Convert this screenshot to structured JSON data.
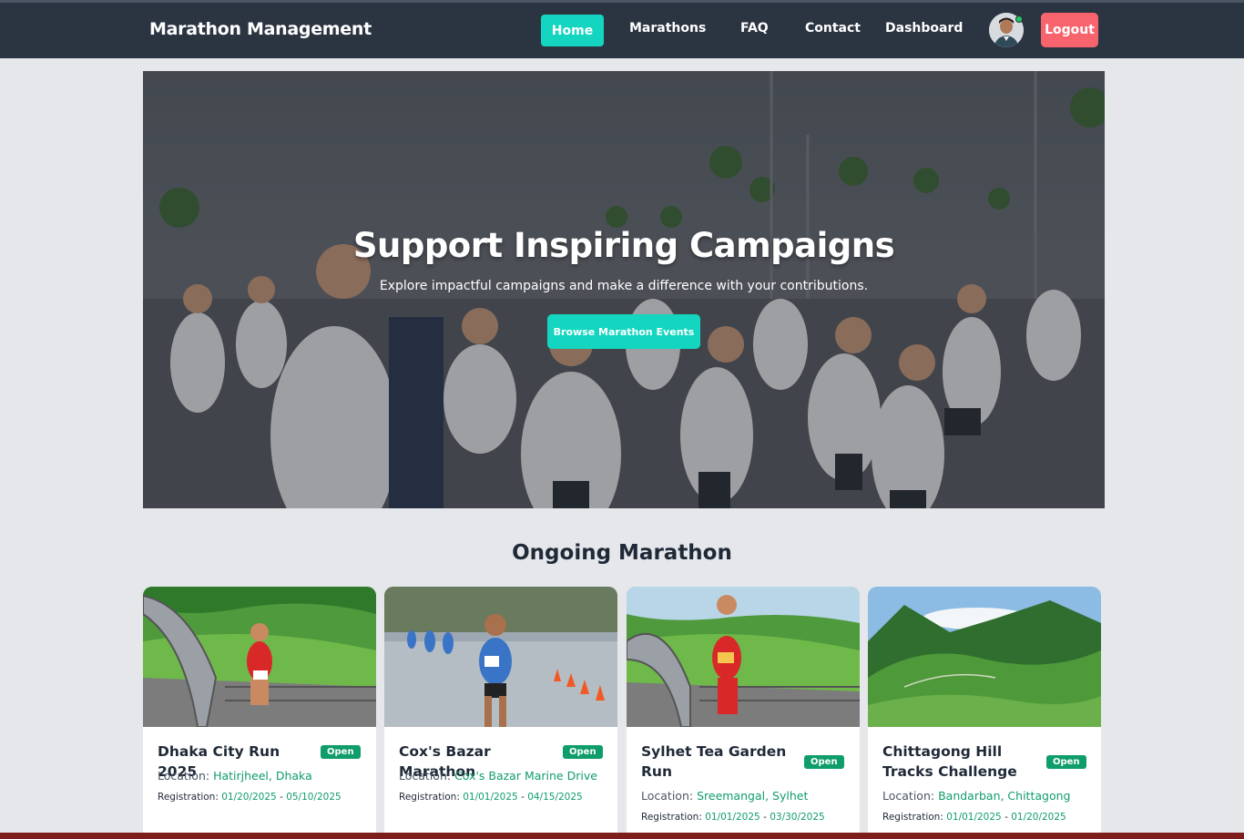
{
  "navbar": {
    "brand": "Marathon Management",
    "links": {
      "home": "Home",
      "marathons": "Marathons",
      "faq": "FAQ",
      "contact": "Contact",
      "dashboard": "Dashboard"
    },
    "logout": "Logout",
    "colors": {
      "bg": "#2b3441",
      "accent": "#14d6c0",
      "logout": "#f8646d"
    }
  },
  "hero": {
    "title": "Support Inspiring Campaigns",
    "subtitle": "Explore impactful campaigns and make a difference with your contributions.",
    "button": "Browse Marathon Events"
  },
  "ongoing": {
    "title": "Ongoing Marathon",
    "cards": [
      {
        "title": "Dhaka City Run 2025",
        "badge": "Open",
        "location_label": "Location:",
        "location": "Hatirjheel, Dhaka",
        "registration_label": "Registration:",
        "reg_start": "01/20/2025",
        "reg_sep": " - ",
        "reg_end": "05/10/2025"
      },
      {
        "title": "Cox's Bazar Marathon",
        "badge": "Open",
        "location_label": "Location:",
        "location": "Cox's Bazar Marine Drive",
        "registration_label": "Registration:",
        "reg_start": "01/01/2025",
        "reg_sep": " - ",
        "reg_end": "04/15/2025"
      },
      {
        "title": "Sylhet Tea Garden Run",
        "badge": "Open",
        "location_label": "Location:",
        "location": "Sreemangal, Sylhet",
        "registration_label": "Registration:",
        "reg_start": "01/01/2025",
        "reg_sep": " - ",
        "reg_end": "03/30/2025"
      },
      {
        "title": "Chittagong Hill Tracks Challenge",
        "badge": "Open",
        "location_label": "Location:",
        "location": "Bandarban, Chittagong",
        "registration_label": "Registration:",
        "reg_start": "01/01/2025",
        "reg_sep": " - ",
        "reg_end": "01/20/2025"
      }
    ]
  }
}
